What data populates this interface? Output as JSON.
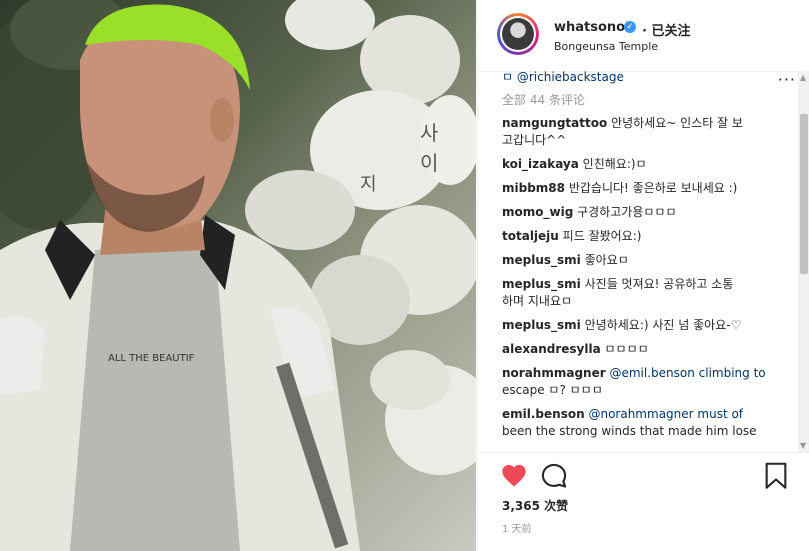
{
  "header": {
    "username": "whatsonot",
    "follow_label": "· 已关注",
    "location": "Bongeunsa Temple"
  },
  "comments": {
    "top_mention": "ㅁ @richiebackstage",
    "all_count_label": "全部 44 条评论",
    "items": [
      {
        "user": "namgungtattoo",
        "text": "안녕하세요~ 인스타 잘 보"
      },
      {
        "user": "",
        "text": "고갑니다^^"
      },
      {
        "user": "koi_izakaya",
        "text": "인친해요:)ㅁ"
      },
      {
        "user": "mibbm88",
        "text": "반갑습니다! 좋은하로 보내세요 :)"
      },
      {
        "user": "momo_wig",
        "text": "구경하고가용ㅁㅁㅁ"
      },
      {
        "user": "totaljeju",
        "text": "피드 잘봤어요:)"
      },
      {
        "user": "meplus_smi",
        "text": "좋아요ㅁ"
      },
      {
        "user": "meplus_smi",
        "text": "사진들 멋져요! 공유하고 소통"
      },
      {
        "user": "",
        "text": "하며 지내요ㅁ"
      },
      {
        "user": "meplus_smi",
        "text": "안녕하세요:) 사진 넘 좋아요-♡"
      },
      {
        "user": "alexandresylla",
        "text": "ㅁㅁㅁㅁ"
      },
      {
        "user": "norahmmagner",
        "text": "@emil.benson climbing to"
      },
      {
        "user": "",
        "text": "escape ㅁ? ㅁㅁㅁ"
      },
      {
        "user": "emil.benson",
        "text": "@norahmmagner must of"
      },
      {
        "user": "",
        "text": "been the strong winds that made him lose"
      }
    ]
  },
  "photo": {
    "shirt_text": "ALL THE BEAUTIF"
  },
  "actions": {
    "likes_label": "3,365 次赞",
    "time_label": "1 天前"
  },
  "colors": {
    "heart": "#ed4956",
    "verified": "#3897f0",
    "hair": "#9adf2a"
  },
  "icons": [
    "heart-icon",
    "comment-icon",
    "bookmark-icon",
    "verified-icon",
    "more-icon"
  ]
}
